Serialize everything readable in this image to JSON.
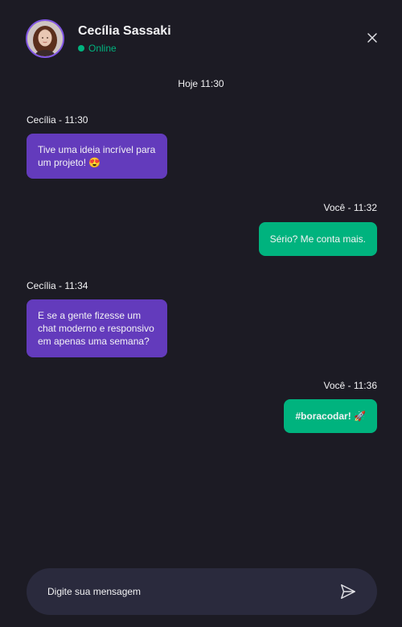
{
  "contact": {
    "name": "Cecília Sassaki",
    "status": "Online"
  },
  "day_label": "Hoje 11:30",
  "messages": [
    {
      "meta": "Cecília - 11:30",
      "text": "Tive uma ideia incrível para um projeto! 😍",
      "from": "contact"
    },
    {
      "meta": "Você - 11:32",
      "text": "Sério? Me conta mais.",
      "from": "me"
    },
    {
      "meta": "Cecília - 11:34",
      "text": "E se a gente fizesse um chat moderno e responsivo em apenas uma semana?",
      "from": "contact"
    },
    {
      "meta": "Você - 11:36",
      "text": "#boracodar! 🚀",
      "from": "me"
    }
  ],
  "composer": {
    "placeholder": "Digite sua mensagem"
  },
  "colors": {
    "background": "#1c1b24",
    "incoming_bubble": "#633bbc",
    "outgoing_bubble": "#00b37e",
    "online": "#00b37e",
    "composer": "#2a2a3d"
  },
  "icons": {
    "close": "close-icon",
    "send": "send-icon"
  }
}
